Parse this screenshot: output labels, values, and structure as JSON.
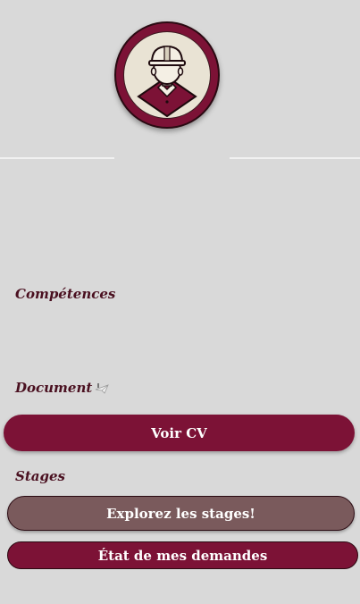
{
  "profile": {
    "avatar_icon": "construction-worker-icon"
  },
  "sections": {
    "competences_title": "Compétences",
    "document_title": "Document",
    "document_icon": "plane-icon",
    "stages_title": "Stages"
  },
  "buttons": {
    "view_cv": "Voir CV",
    "explore_stages": "Explorez les stages!",
    "request_status": "État de mes demandes"
  },
  "colors": {
    "background": "#d9d9d9",
    "primary": "#7c1236",
    "secondary": "#7a5a5c",
    "title_text": "#4a1020"
  }
}
